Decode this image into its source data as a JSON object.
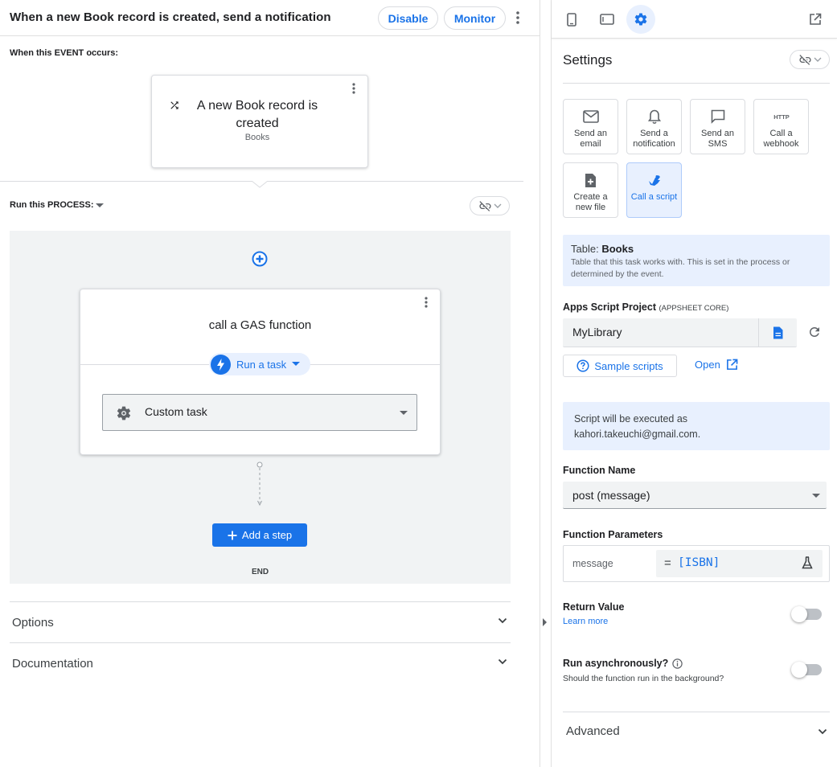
{
  "header": {
    "title": "When a new Book record is created, send a notification",
    "disable_label": "Disable",
    "monitor_label": "Monitor"
  },
  "event": {
    "section_label": "When this EVENT occurs:",
    "title": "A new Book record is created",
    "table": "Books",
    "icon": "shuffle-icon"
  },
  "process": {
    "section_label": "Run this PROCESS:",
    "step_title": "call a GAS function",
    "run_task_label": "Run a task",
    "task_type": "Custom task",
    "add_step_label": "Add a step",
    "end_label": "END"
  },
  "accordions": {
    "options": "Options",
    "documentation": "Documentation"
  },
  "settings": {
    "title": "Settings",
    "tiles": [
      {
        "label": "Send an email",
        "icon": "mail-icon",
        "selected": false
      },
      {
        "label": "Send a notification",
        "icon": "bell-icon",
        "selected": false
      },
      {
        "label": "Send an SMS",
        "icon": "chat-icon",
        "selected": false
      },
      {
        "label": "Call a webhook",
        "icon": "http-icon",
        "selected": false
      },
      {
        "label": "Create a new file",
        "icon": "add-file-icon",
        "selected": false
      },
      {
        "label": "Call a script",
        "icon": "script-icon",
        "selected": true
      }
    ],
    "table_info": {
      "prefix": "Table: ",
      "name": "Books",
      "description": "Table that this task works with. This is set in the process or determined by the event."
    },
    "apps_script": {
      "label": "Apps Script Project",
      "sublabel": "(APPSHEET CORE)",
      "value": "MyLibrary",
      "sample_scripts_label": "Sample scripts",
      "open_label": "Open"
    },
    "execution_info": "Script will be executed as kahori.takeuchi@gmail.com.",
    "function_name": {
      "label": "Function Name",
      "value": "post (message)"
    },
    "function_parameters": {
      "label": "Function Parameters",
      "name": "message",
      "equals": "=",
      "value": "[ISBN]"
    },
    "return_value": {
      "label": "Return Value",
      "learn_more": "Learn more",
      "enabled": false
    },
    "run_async": {
      "label": "Run asynchronously?",
      "description": "Should the function run in the background?",
      "enabled": false
    },
    "advanced_label": "Advanced"
  },
  "colors": {
    "accent": "#1a73e8",
    "selected_bg": "#e8f0fe",
    "panel_bg": "#f1f3f4"
  }
}
